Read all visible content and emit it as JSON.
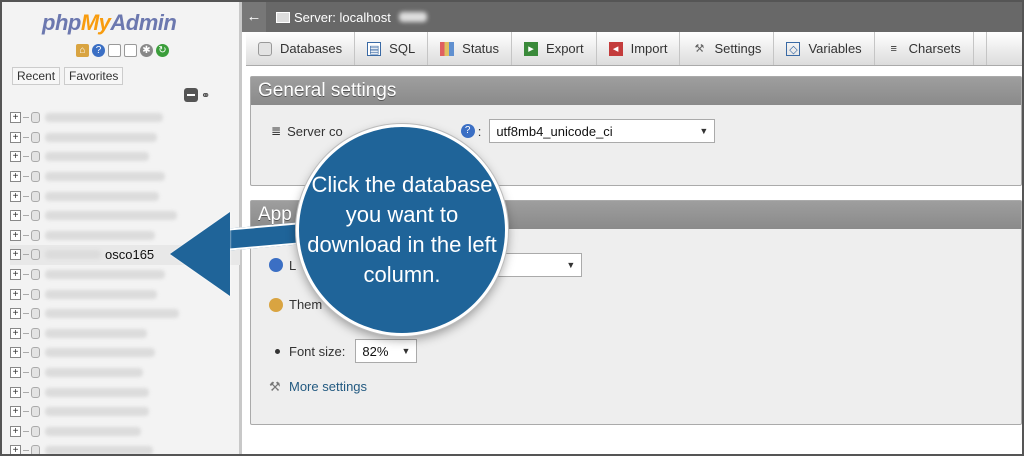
{
  "nav": {
    "logo_prefix": "php",
    "logo_accent": "My",
    "logo_suffix": "Admin",
    "icons": [
      "home-icon",
      "help-icon",
      "docs-icon",
      "copy-icon",
      "gear-icon",
      "reload-icon"
    ],
    "tabs": [
      "Recent",
      "Favorites"
    ],
    "selected_db": "osco165",
    "tree_rows": 18,
    "selected_index": 7
  },
  "topbar": {
    "back": "←",
    "server_label": "Server: localhost"
  },
  "tabs": [
    {
      "label": "Databases",
      "icon": "database-icon"
    },
    {
      "label": "SQL",
      "icon": "sql-icon"
    },
    {
      "label": "Status",
      "icon": "status-icon"
    },
    {
      "label": "Export",
      "icon": "export-icon"
    },
    {
      "label": "Import",
      "icon": "import-icon"
    },
    {
      "label": "Settings",
      "icon": "wrench-icon"
    },
    {
      "label": "Variables",
      "icon": "variables-icon"
    },
    {
      "label": "Charsets",
      "icon": "charsets-icon"
    }
  ],
  "general": {
    "title": "General settings",
    "collation_label_start": "Server co",
    "collation_label_end": ":",
    "collation_value": "utf8mb4_unicode_ci"
  },
  "appearance": {
    "title_start": "App",
    "language_start": "L",
    "theme_start": "Them",
    "font_size_label": "Font size:",
    "font_size_value": "82%",
    "more_settings": "More settings"
  },
  "callout": {
    "text": "Click the database you want to download in the left column."
  },
  "colors": {
    "callout_blue": "#1f6499",
    "topbar": "#686868",
    "fieldset_title": "#929292"
  }
}
